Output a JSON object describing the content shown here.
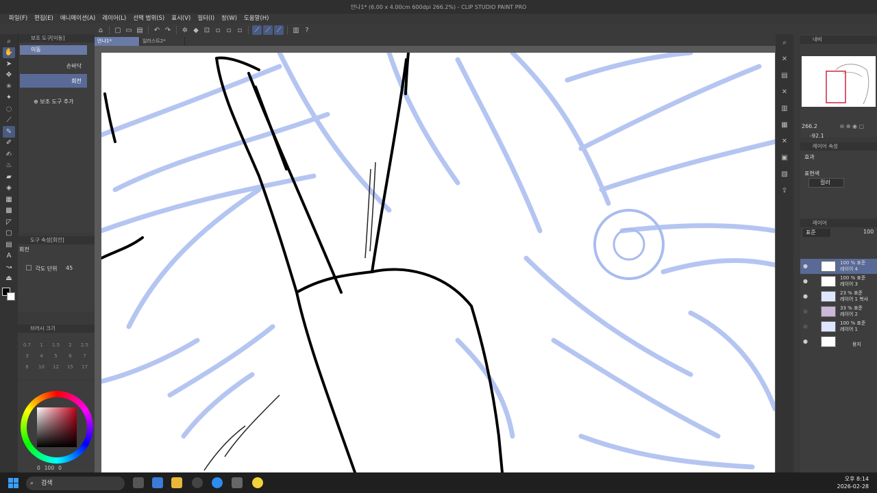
{
  "window": {
    "title": "안나1* (6.00 x 4.00cm 600dpi 266.2%)  - CLIP STUDIO PAINT PRO"
  },
  "menu": [
    "파일(F)",
    "편집(E)",
    "애니메이션(A)",
    "레이어(L)",
    "선택 범위(S)",
    "표시(V)",
    "필터(I)",
    "창(W)",
    "도움말(H)"
  ],
  "doc_tabs": [
    "안나1*",
    "일러스트2*"
  ],
  "subtool": {
    "header": "보조 도구[이동]",
    "selected": "이동",
    "item2": "손바닥",
    "item3": "회전",
    "add": "보조 도구 추가"
  },
  "tool_property": {
    "header": "도구 속성[회전]",
    "title": "회전",
    "angle_label": "각도 단위",
    "angle_value": "45"
  },
  "brush_size": {
    "header": "브러시 크기",
    "sizes": [
      "0.7",
      "1",
      "1.5",
      "2",
      "2.5",
      "3",
      "4",
      "5",
      "6",
      "7",
      "8",
      "10",
      "12",
      "15",
      "17"
    ]
  },
  "color": {
    "accent": "#c0001a",
    "opacity_readout": "0",
    "percent_readout": "100",
    "last_readout": "0"
  },
  "navigator": {
    "header": "내비",
    "zoom": "266.2",
    "rotation": "-92.1"
  },
  "layer_property": {
    "header": "레이어 속성",
    "effect_label": "효과",
    "expression_label": "표현색",
    "expression_value": "컬러"
  },
  "layers": {
    "header": "레이어",
    "blend": "표준",
    "opacity": "100",
    "items": [
      {
        "pct": "100 % 표준",
        "name": "레이어 4"
      },
      {
        "pct": "100 % 표준",
        "name": "레이어 3"
      },
      {
        "pct": "23 % 표준",
        "name": "레이어 1 복사"
      },
      {
        "pct": "33 % 표준",
        "name": "레이어 2"
      },
      {
        "pct": "100 % 표준",
        "name": "레이어 1"
      },
      {
        "pct": "",
        "name": "용지"
      }
    ]
  },
  "taskbar": {
    "search": "검색",
    "time": "오후 8:14",
    "date": "2026-02-28"
  }
}
